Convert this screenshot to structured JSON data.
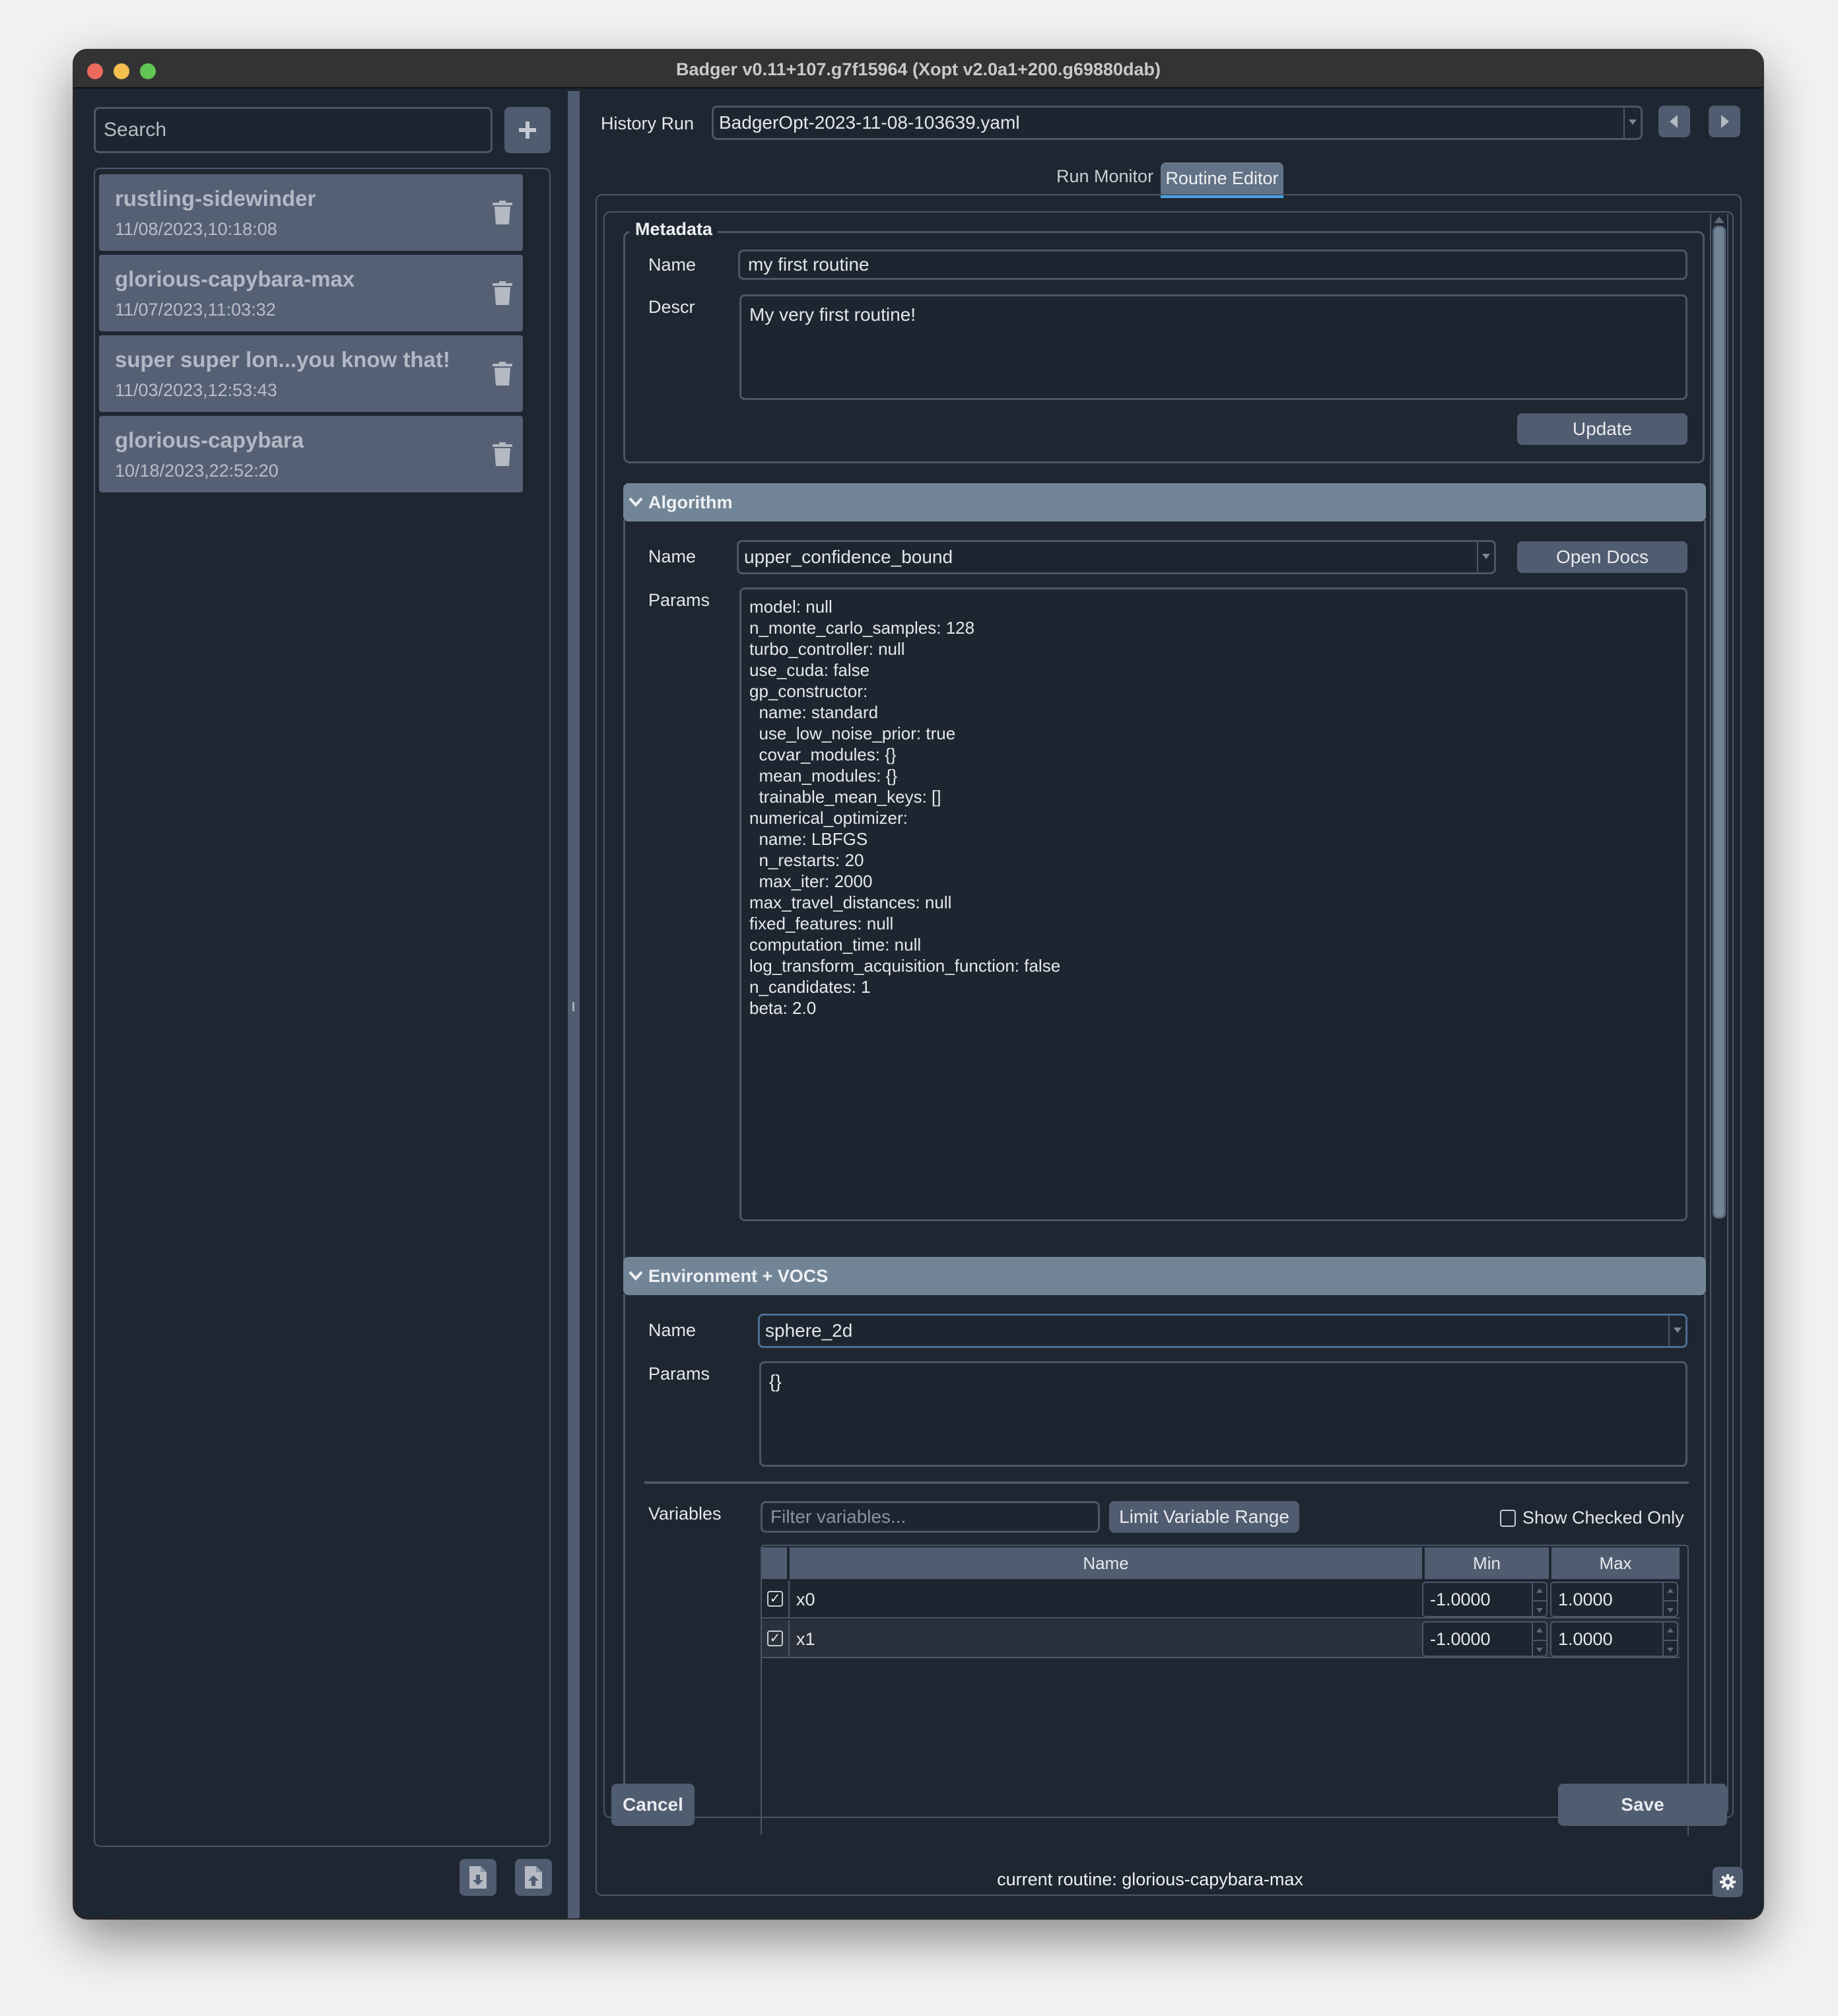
{
  "window": {
    "title": "Badger v0.11+107.g7f15964 (Xopt v2.0a1+200.g69880dab)"
  },
  "sidebar": {
    "search_placeholder": "Search",
    "add_button_icon": "plus-icon",
    "routines": [
      {
        "name": "rustling-sidewinder",
        "date": "11/08/2023,10:18:08"
      },
      {
        "name": "glorious-capybara-max",
        "date": "11/07/2023,11:03:32"
      },
      {
        "name": "super super lon...you know that!",
        "date": "11/03/2023,12:53:43"
      },
      {
        "name": "glorious-capybara",
        "date": "10/18/2023,22:52:20"
      }
    ],
    "footer_icons": [
      "file-import-icon",
      "file-export-icon"
    ]
  },
  "history": {
    "label": "History Run",
    "value": "BadgerOpt-2023-11-08-103639.yaml"
  },
  "tabs": [
    {
      "label": "Run Monitor",
      "active": false
    },
    {
      "label": "Routine Editor",
      "active": true
    }
  ],
  "metadata": {
    "title": "Metadata",
    "name_label": "Name",
    "name_value": "my first routine",
    "descr_label": "Descr",
    "descr_value": "My very first routine!",
    "update_label": "Update"
  },
  "algorithm": {
    "title": "Algorithm",
    "name_label": "Name",
    "name_value": "upper_confidence_bound",
    "open_docs_label": "Open Docs",
    "params_label": "Params",
    "params_lines": [
      "model: null",
      "n_monte_carlo_samples: 128",
      "turbo_controller: null",
      "use_cuda: false",
      "gp_constructor:",
      "  name: standard",
      "  use_low_noise_prior: true",
      "  covar_modules: {}",
      "  mean_modules: {}",
      "  trainable_mean_keys: []",
      "numerical_optimizer:",
      "  name: LBFGS",
      "  n_restarts: 20",
      "  max_iter: 2000",
      "max_travel_distances: null",
      "fixed_features: null",
      "computation_time: null",
      "log_transform_acquisition_function: false",
      "n_candidates: 1",
      "beta: 2.0"
    ]
  },
  "environment": {
    "title": "Environment + VOCS",
    "name_label": "Name",
    "name_value": "sphere_2d",
    "params_label": "Params",
    "params_value": "{}",
    "variables_label": "Variables",
    "filter_placeholder": "Filter variables...",
    "limit_range_label": "Limit Variable Range",
    "show_checked_label": "Show Checked Only",
    "show_checked": false,
    "table": {
      "columns": [
        "Name",
        "Min",
        "Max"
      ],
      "rows": [
        {
          "checked": true,
          "name": "x0",
          "min": "-1.0000",
          "max": "1.0000"
        },
        {
          "checked": true,
          "name": "x1",
          "min": "-1.0000",
          "max": "1.0000"
        }
      ]
    }
  },
  "actions": {
    "cancel_label": "Cancel",
    "save_label": "Save"
  },
  "status": {
    "text": "current routine: glorious-capybara-max"
  },
  "colors": {
    "background": "#1e2631",
    "accent_tab": "#4aa3e8",
    "section_header": "#728597",
    "button": "#505c70",
    "list_item": "#566075"
  }
}
